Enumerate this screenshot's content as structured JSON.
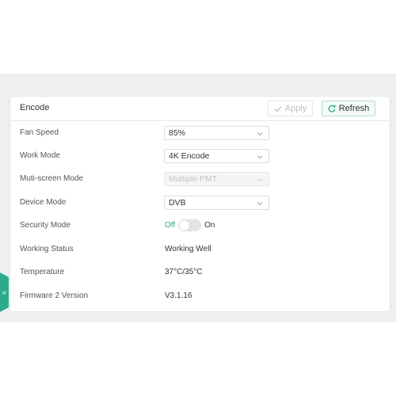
{
  "panel": {
    "title": "Encode",
    "apply_label": "Apply",
    "refresh_label": "Refresh"
  },
  "rows": {
    "fan_speed": {
      "label": "Fan Speed",
      "value": "85%"
    },
    "work_mode": {
      "label": "Work Mode",
      "value": "4K Encode"
    },
    "multi_screen_mode": {
      "label": "Muti-screen Mode",
      "value": "Multiple PMT",
      "disabled": true
    },
    "device_mode": {
      "label": "Device Mode",
      "value": "DVB"
    },
    "security_mode": {
      "label": "Security Mode",
      "off_label": "Off",
      "on_label": "On",
      "state": "off"
    },
    "working_status": {
      "label": "Working Status",
      "value": "Working Well"
    },
    "temperature": {
      "label": "Temperature",
      "value": "37°C/35°C"
    },
    "firmware": {
      "label": "Firmware 2 Version",
      "value": "V3.1.16"
    }
  },
  "icons": {
    "apply": "check-icon",
    "refresh": "refresh-icon",
    "select_arrow": "chevron-down-icon",
    "side_tab": "double-chevron-left-icon"
  },
  "colors": {
    "accent": "#2bab8a",
    "backdrop": "#eeeff1",
    "disabled_text": "#c4c4c4"
  },
  "side_tab": {
    "glyph": "«"
  }
}
